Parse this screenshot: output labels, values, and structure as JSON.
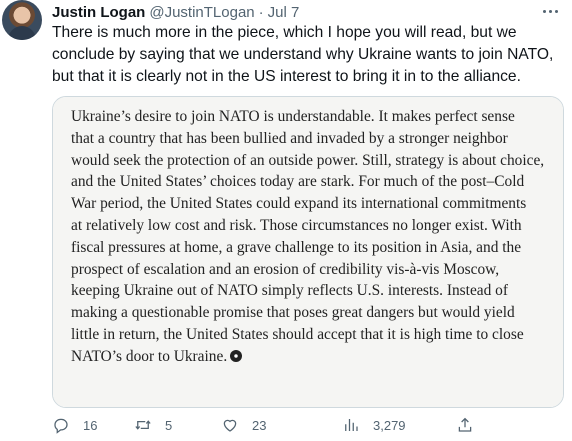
{
  "author": {
    "name": "Justin Logan",
    "handle": "@JustinTLogan",
    "separator": "·",
    "date": "Jul 7"
  },
  "tweet_text": "There is much more in the piece, which I hope you will read, but we conclude by saying that we understand why Ukraine wants to join NATO, but that it is clearly not in the US interest to bring it in to the alliance.",
  "quote_image": {
    "lines": [
      "Ukraine’s desire to join NATO is understandable. It makes perfect sense",
      "that a country that has been bullied and invaded by a stronger neighbor",
      "would seek the protection of an outside power. Still, strategy is about choice,",
      "and the United States’ choices today are stark. For much of the post–Cold",
      "War period, the United States could expand its international commitments",
      "at relatively low cost and risk. Those circumstances no longer exist. With",
      "fiscal pressures at home, a grave challenge to its position in Asia, and the",
      "prospect of escalation and an erosion of credibility vis-à-vis Moscow,",
      "keeping Ukraine out of NATO simply reflects U.S. interests. Instead of",
      "making a questionable promise that poses great dangers but would yield",
      "little in return, the United States should accept that it is high time to close",
      "NATO’s door to Ukraine."
    ]
  },
  "actions": {
    "replies": "16",
    "retweets": "5",
    "likes": "23",
    "views": "3,279"
  },
  "icons": {
    "reply": "reply-icon",
    "retweet": "retweet-icon",
    "like": "heart-icon",
    "views": "views-icon",
    "share": "share-icon",
    "more": "more-icon"
  },
  "colors": {
    "text": "#0f1419",
    "secondary": "#536471",
    "border": "#cfd9de"
  }
}
